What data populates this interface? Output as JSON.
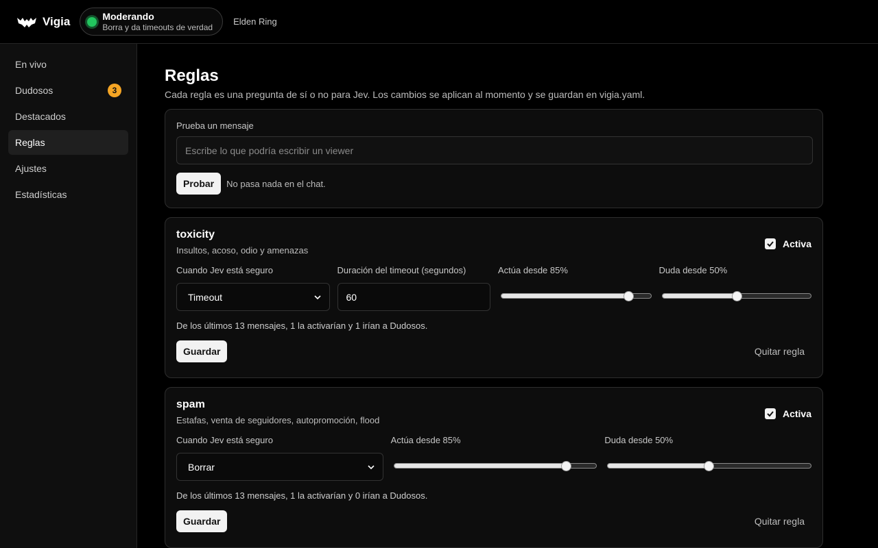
{
  "header": {
    "app_name": "Vigia",
    "logo_icon": "bat-icon",
    "status_title": "Moderando",
    "status_subtitle": "Borra y da timeouts de verdad",
    "status_color": "#22c55e",
    "game": "Elden Ring"
  },
  "sidebar": {
    "items": [
      {
        "label": "En vivo"
      },
      {
        "label": "Dudosos",
        "badge": "3"
      },
      {
        "label": "Destacados"
      },
      {
        "label": "Reglas",
        "active": true
      },
      {
        "label": "Ajustes"
      },
      {
        "label": "Estadísticas"
      }
    ],
    "badge_color": "#f5a524"
  },
  "page": {
    "title": "Reglas",
    "description": "Cada regla es una pregunta de sí o no para Jev. Los cambios se aplican al momento y se guardan en vigia.yaml."
  },
  "tester": {
    "label": "Prueba un mensaje",
    "placeholder": "Escribe lo que podría escribir un viewer",
    "value": "",
    "button": "Probar",
    "result": "No pasa nada en el chat."
  },
  "rules": [
    {
      "name": "toxicity",
      "description": "Insultos, acoso, odio y amenazas",
      "active_label": "Activa",
      "active": true,
      "action_label": "Cuando Jev está seguro",
      "action_value": "Timeout",
      "duration_label": "Duración del timeout (segundos)",
      "duration_value": "60",
      "act_label": "Actúa desde 85%",
      "act_threshold": 0.85,
      "doubt_label": "Duda desde 50%",
      "doubt_threshold": 0.5,
      "summary": "De los últimos 13 mensajes, 1 la activarían y 1 irían a Dudosos.",
      "save": "Guardar",
      "remove": "Quitar regla"
    },
    {
      "name": "spam",
      "description": "Estafas, venta de seguidores, autopromoción, flood",
      "active_label": "Activa",
      "active": true,
      "action_label": "Cuando Jev está seguro",
      "action_value": "Borrar",
      "act_label": "Actúa desde 85%",
      "act_threshold": 0.85,
      "doubt_label": "Duda desde 50%",
      "doubt_threshold": 0.5,
      "summary": "De los últimos 13 mensajes, 1 la activarían y 0 irían a Dudosos.",
      "save": "Guardar",
      "remove": "Quitar regla"
    }
  ]
}
